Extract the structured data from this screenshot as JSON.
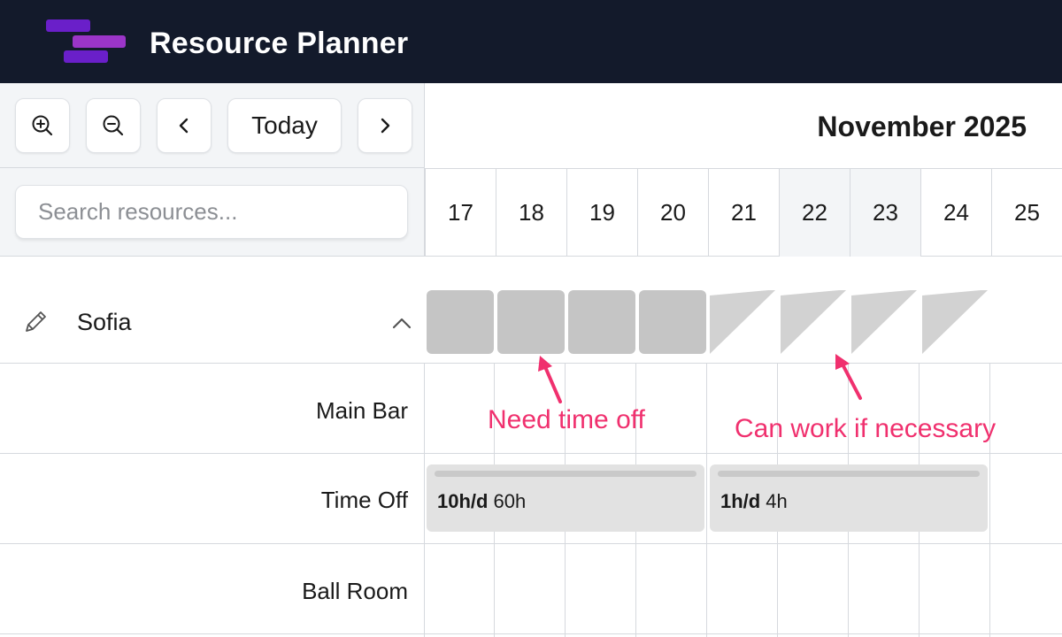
{
  "app": {
    "title": "Resource Planner"
  },
  "toolbar": {
    "zoom_in_icon": "zoom-in-icon",
    "zoom_out_icon": "zoom-out-icon",
    "prev_icon": "chevron-left-icon",
    "today_label": "Today",
    "next_icon": "chevron-right-icon"
  },
  "search": {
    "placeholder": "Search resources..."
  },
  "calendar": {
    "month_label": "November 2025",
    "days": [
      "17",
      "18",
      "19",
      "20",
      "21",
      "22",
      "23",
      "24",
      "25"
    ],
    "weekend_days": [
      "22",
      "23"
    ]
  },
  "resource": {
    "name": "Sofia",
    "availability": [
      "full",
      "full",
      "full",
      "full",
      "partial",
      "partial",
      "partial",
      "partial"
    ],
    "rows": [
      {
        "label": "Main Bar"
      },
      {
        "label": "Time Off"
      },
      {
        "label": "Ball Room"
      }
    ]
  },
  "bookings": [
    {
      "rate": "10h/d",
      "total": "60h"
    },
    {
      "rate": "1h/d",
      "total": "4h"
    }
  ],
  "annotations": [
    {
      "text": "Need time off"
    },
    {
      "text": "Can work if necessary"
    }
  ],
  "colors": {
    "header_bg": "#131a2b",
    "accent_purple": "#6a1fc9",
    "annotation": "#f0306e",
    "availability_block": "#c5c5c5",
    "booking_bg": "#e2e2e2"
  }
}
